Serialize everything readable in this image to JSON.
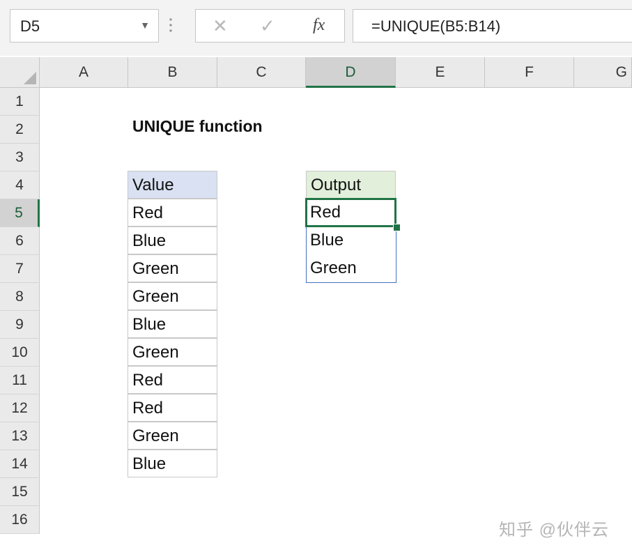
{
  "formula_bar": {
    "name_box": "D5",
    "cancel_symbol": "✕",
    "enter_symbol": "✓",
    "fx_label": "fx",
    "formula": "=UNIQUE(B5:B14)"
  },
  "columns": [
    "A",
    "B",
    "C",
    "D",
    "E",
    "F",
    "G"
  ],
  "selected_column": "D",
  "rows": [
    "1",
    "2",
    "3",
    "4",
    "5",
    "6",
    "7",
    "8",
    "9",
    "10",
    "11",
    "12",
    "13",
    "14",
    "15",
    "16"
  ],
  "selected_row": "5",
  "sheet": {
    "title": "UNIQUE function",
    "value_header": "Value",
    "values": [
      "Red",
      "Blue",
      "Green",
      "Green",
      "Blue",
      "Green",
      "Red",
      "Red",
      "Green",
      "Blue"
    ],
    "output_header": "Output",
    "outputs": [
      "Red",
      "Blue",
      "Green"
    ]
  },
  "colors": {
    "accent": "#217346",
    "value_header_fill": "#d9e1f2",
    "output_header_fill": "#e2efda",
    "spill_border": "#4472c4"
  },
  "watermark": "知乎 @伙伴云"
}
